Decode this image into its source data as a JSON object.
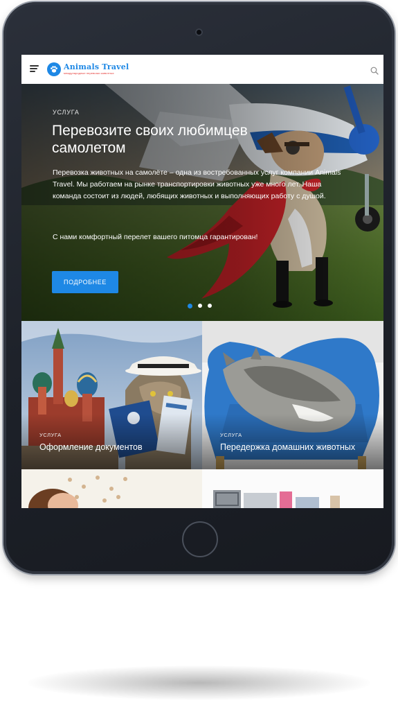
{
  "header": {
    "logo_title": "Animals Travel",
    "logo_subtitle": "международные перевозки животных",
    "icons": [
      "menu-icon",
      "paw-icon",
      "search-icon"
    ]
  },
  "hero": {
    "tag": "Услуга",
    "title": "Перевозите своих любимцев самолетом",
    "description": "Перевозка животных на самолёте – одна из востребованных услуг компании Animals Travel. Мы работаем на рынке транспортировки животных уже много лет. Наша команда состоит из людей, любящих животных и выполняющих работу с душой.",
    "description_2": "С нами комфортный перелет вашего питомца гарантирован!",
    "button_label": "Подробнее",
    "slides_total": 3,
    "active_slide": 1
  },
  "cards": [
    {
      "tag": "Услуга",
      "title": "Оформление документов"
    },
    {
      "tag": "Услуга",
      "title": "Передержка домашних животных"
    }
  ],
  "colors": {
    "accent": "#1e88e5",
    "device": "#1d2129",
    "logo_sub": "#e53935"
  }
}
